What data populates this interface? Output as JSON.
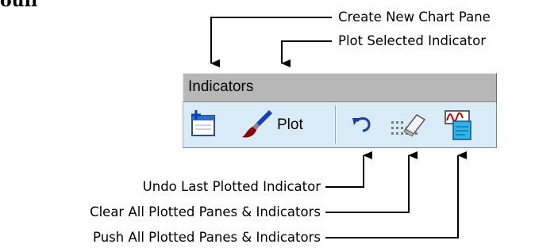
{
  "fragment": "oull",
  "toolbar": {
    "title": "Indicators",
    "plot_label": "Plot",
    "buttons": [
      {
        "name": "create-new-chart-pane-button",
        "icon": "new-pane-icon"
      },
      {
        "name": "plot-button",
        "icon": "paintbrush-icon"
      },
      {
        "name": "undo-button",
        "icon": "undo-arrow-icon"
      },
      {
        "name": "clear-all-button",
        "icon": "eraser-icon"
      },
      {
        "name": "push-all-button",
        "icon": "push-panes-icon"
      }
    ]
  },
  "callouts": {
    "create_new_pane": "Create New Chart Pane",
    "plot_selected": "Plot Selected Indicator",
    "undo_last": "Undo Last Plotted Indicator",
    "clear_all": "Clear All Plotted Panes & Indicators",
    "push_all": "Push All Plotted Panes & Indicators"
  },
  "colors": {
    "title_bar": "#b7b7b7",
    "toolbar_body": "#d8ebf7"
  }
}
